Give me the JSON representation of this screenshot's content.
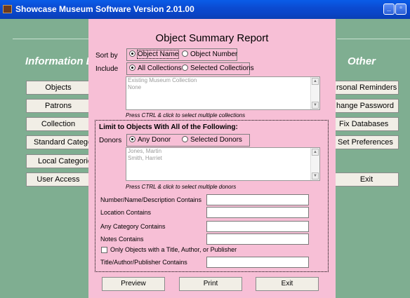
{
  "window": {
    "title": "Showcase Museum Software Version 2.01.00"
  },
  "main": {
    "left_section_title": "Information Ei",
    "right_section_title": "Other",
    "left_buttons": [
      "Objects",
      "Patrons",
      "Collection",
      "Standard Categori",
      "Local Categories",
      "User Access"
    ],
    "right_buttons": [
      "rsonal Reminders",
      "hange Password",
      "Fix Databases",
      "Set Preferences",
      "Exit"
    ]
  },
  "dialog": {
    "title": "Object Summary Report",
    "sort_by": {
      "label": "Sort by",
      "options": [
        "Object Name",
        "Object Number"
      ],
      "selected": "Object Name"
    },
    "include": {
      "label": "Include",
      "options": [
        "All Collections",
        "Selected Collections"
      ],
      "selected": "All Collections"
    },
    "collections_list": [
      "Existing Museum Collection",
      "None"
    ],
    "collections_hint": "Press CTRL & click to select multiple collections",
    "limit_group": {
      "title": "Limit to Objects With All of the Following:",
      "donors": {
        "label": "Donors",
        "options": [
          "Any Donor",
          "Selected Donors"
        ],
        "selected": "Any Donor"
      },
      "donors_list": [
        "Jones, Martin",
        "Smith, Harriet"
      ],
      "donors_hint": "Press CTRL & click to select multiple donors",
      "fields": [
        {
          "label": "Number/Name/Description Contains",
          "value": ""
        },
        {
          "label": "Location Contains",
          "value": ""
        },
        {
          "label": "Any Category Contains",
          "value": ""
        },
        {
          "label": "Notes Contains",
          "value": ""
        }
      ],
      "checkbox_label": "Only Objects with a Title, Author, or Publisher",
      "checkbox_checked": false,
      "title_field": {
        "label": "Title/Author/Publisher Contains",
        "value": ""
      }
    },
    "buttons": {
      "preview": "Preview",
      "print": "Print",
      "exit": "Exit"
    }
  }
}
